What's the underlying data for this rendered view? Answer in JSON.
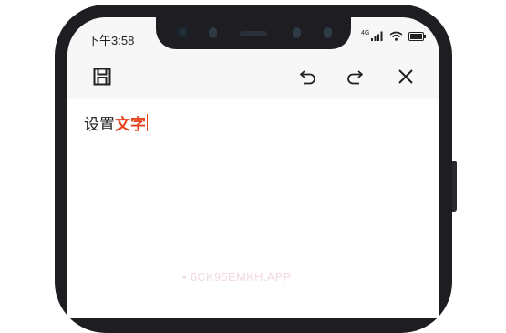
{
  "status_bar": {
    "time": "下午3:58",
    "network_label": "4G"
  },
  "toolbar": {
    "save_icon": "save-icon",
    "undo_icon": "undo-icon",
    "redo_icon": "redo-icon",
    "close_icon": "close-icon"
  },
  "editor": {
    "plain_text": "设置",
    "highlighted_text": "文字"
  },
  "watermark": "• 6CK95EMKH.APP",
  "colors": {
    "accent": "#e8411b",
    "toolbar_bg": "#f7f7f7",
    "frame": "#1e1e22"
  }
}
